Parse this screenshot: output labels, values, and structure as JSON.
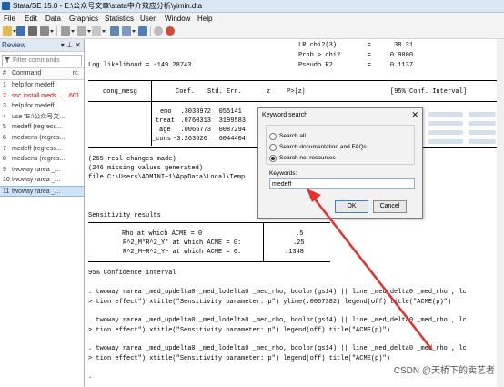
{
  "window": {
    "title": "Stata/SE 15.0 - E:\\公众号文章\\stata中介效应分析\\yimin.dta"
  },
  "menu": [
    "File",
    "Edit",
    "Data",
    "Graphics",
    "Statistics",
    "User",
    "Window",
    "Help"
  ],
  "review": {
    "title": "Review",
    "filter_placeholder": "Filter commands",
    "col_num": "#",
    "col_command": "Command",
    "col_rc": "_rc",
    "rows": [
      {
        "num": "1",
        "cmd": "help for medeff",
        "rc": ""
      },
      {
        "num": "2",
        "cmd": "ssc install meds...",
        "rc": "601"
      },
      {
        "num": "3",
        "cmd": "help for medeff",
        "rc": ""
      },
      {
        "num": "4",
        "cmd": "use \"E:\\公众号文...",
        "rc": ""
      },
      {
        "num": "5",
        "cmd": "medeff (regress...",
        "rc": ""
      },
      {
        "num": "6",
        "cmd": "medsens (regres...",
        "rc": ""
      },
      {
        "num": "7",
        "cmd": "medeff (regress...",
        "rc": ""
      },
      {
        "num": "8",
        "cmd": "medsens (regres...",
        "rc": ""
      },
      {
        "num": "9",
        "cmd": "twoway rarea _...",
        "rc": ""
      },
      {
        "num": "10",
        "cmd": "twoway rarea _...",
        "rc": ""
      },
      {
        "num": "11",
        "cmd": "twoway rarea _...",
        "rc": ""
      }
    ]
  },
  "results": {
    "header_right": [
      "LR chi2(3)        =      38.31",
      "Prob > chi2       =     0.0000",
      "Pseudo R2         =     0.1137"
    ],
    "loglik": "Log likelihood = -149.28743",
    "table_head": [
      "cong_mesg",
      "Coef.",
      "Std. Err.",
      "z",
      "P>|z|",
      "[95% Conf. Interval]"
    ],
    "table_rows": [
      [
        "emo",
        "  .3033972",
        "  .055141"
      ],
      [
        "treat",
        "  .0760313",
        "  .3199583"
      ],
      [
        "age",
        "  .0066773",
        "  .0087294"
      ],
      [
        "_cons",
        "-3.263626",
        "  .6044404"
      ]
    ],
    "notes": [
      "(265 real changes made)",
      "(246 missing values generated)",
      "file C:\\Users\\ADMINI~1\\AppData\\Local\\Temp"
    ],
    "sens_title": "Sensitivity results",
    "sens_rows": [
      [
        "Rho at which ACME = 0",
        ".5"
      ],
      [
        "R^2_M*R^2_Y* at which ACME = 0:",
        ".25"
      ],
      [
        "R^2_M~R^2_Y~ at which ACME = 0:",
        ".1348"
      ]
    ],
    "ci": "95% Confidence interval",
    "cmd_lines": [
      ". twoway rarea _med_updelta0 _med_lodelta0 _med_rho, bcolor(gs14) || line _med_delta0 _med_rho , lc",
      "> tion effect\") xtitle(\"Sensitivity parameter: p\") yline(.0067382) legend(off) title(\"ACME(p)\")",
      ". twoway rarea _med_updelta0 _med_lodelta0 _med_rho, bcolor(gs14) || line _med_delta0 _med_rho , lc",
      "> tion effect\") xtitle(\"Sensitivity parameter: p\") legend(off) title(\"ACME(p)\")",
      ". twoway rarea _med_updelta0 _med_lodelta0 _med_rho, bcolor(gs14) || line _med_delta0 _med_rho , lc",
      "> tion effect\") xtitle(\"Sensitivity parameter: p\") legend(off) title(\"ACME(p)\")"
    ],
    "prompt": "."
  },
  "dialog": {
    "title": "Keyword search",
    "close": "✕",
    "options": [
      "Search all",
      "Search documentation and FAQs",
      "Search net resources"
    ],
    "selected_option": 2,
    "keywords_label": "Keywords:",
    "keywords_value": "medeff",
    "ok": "OK",
    "cancel": "Cancel"
  },
  "watermark": "CSDN @天桥下的卖艺者",
  "colors": {
    "error": "#d10000",
    "selection": "#cfe3f7",
    "arrow": "#e8302a",
    "titlebar": "#dbe6f4"
  }
}
